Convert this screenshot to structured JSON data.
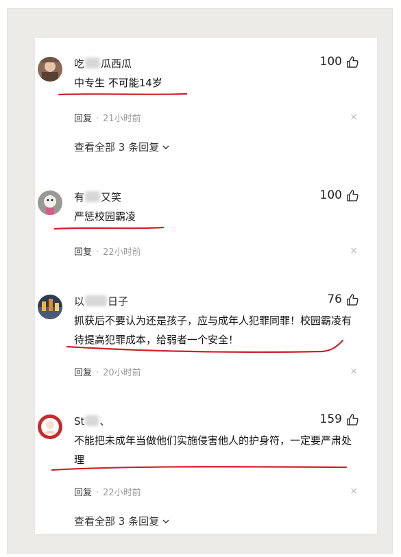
{
  "comments": [
    {
      "user_prefix": "吃",
      "user_suffix": "瓜西瓜",
      "likes": "100",
      "content": "中专生 不可能14岁",
      "reply_label": "回复",
      "time": "21小时前",
      "close_glyph": "×",
      "view_all": "查看全部 3 条回复"
    },
    {
      "user_prefix": "有",
      "user_suffix": "又笑",
      "likes": "100",
      "content": "严惩校园霸凌",
      "reply_label": "回复",
      "time": "22小时前",
      "close_glyph": "×"
    },
    {
      "user_prefix": "以",
      "user_suffix": "日子",
      "likes": "76",
      "content": "抓获后不要认为还是孩子，应与成年人犯罪同罪！校园霸凌有待提高犯罪成本，给弱者一个安全！",
      "reply_label": "回复",
      "time": "20小时前",
      "close_glyph": "×"
    },
    {
      "user_prefix": "St",
      "user_suffix": "、",
      "likes": "159",
      "content": "不能把未成年当做他们实施侵害他人的护身符，一定要严肃处理",
      "reply_label": "回复",
      "time": "22小时前",
      "close_glyph": "×",
      "view_all": "查看全部 3 条回复"
    }
  ],
  "colors": {
    "underline": "#d0202a",
    "text": "#222222",
    "meta": "#999999"
  }
}
